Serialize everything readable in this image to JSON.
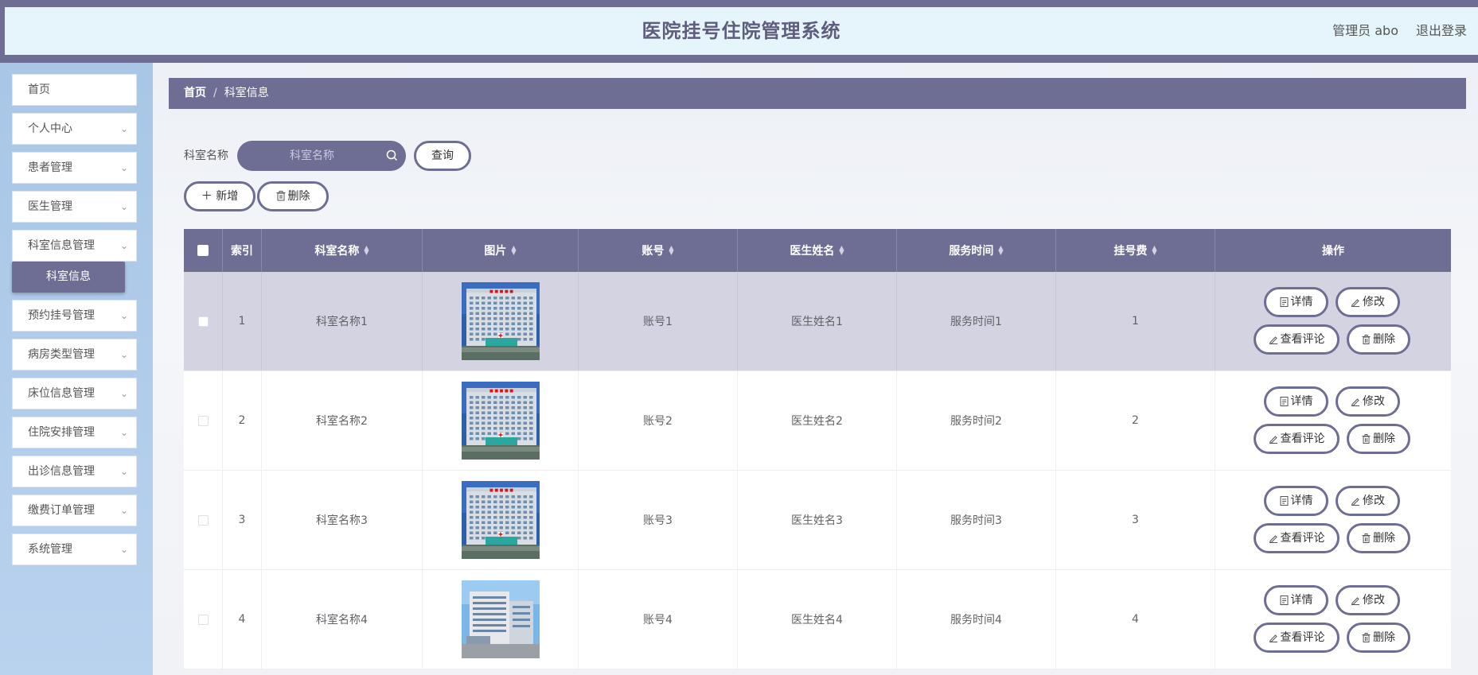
{
  "header": {
    "title": "医院挂号住院管理系统",
    "admin": "管理员 abo",
    "logout": "退出登录"
  },
  "sidebar": {
    "items": [
      {
        "label": "首页",
        "has_arrow": false
      },
      {
        "label": "个人中心",
        "has_arrow": true
      },
      {
        "label": "患者管理",
        "has_arrow": true
      },
      {
        "label": "医生管理",
        "has_arrow": true
      },
      {
        "label": "科室信息管理",
        "has_arrow": true
      },
      {
        "label": "预约挂号管理",
        "has_arrow": true
      },
      {
        "label": "病房类型管理",
        "has_arrow": true
      },
      {
        "label": "床位信息管理",
        "has_arrow": true
      },
      {
        "label": "住院安排管理",
        "has_arrow": true
      },
      {
        "label": "出诊信息管理",
        "has_arrow": true
      },
      {
        "label": "缴费订单管理",
        "has_arrow": true
      },
      {
        "label": "系统管理",
        "has_arrow": true
      }
    ],
    "active_sub": "科室信息"
  },
  "breadcrumb": {
    "home": "首页",
    "sep": "/",
    "current": "科室信息"
  },
  "search": {
    "label": "科室名称",
    "placeholder": "科室名称",
    "query_button": "查询"
  },
  "toolbar": {
    "add": "新增",
    "delete": "删除"
  },
  "table": {
    "headers": [
      "索引",
      "科室名称",
      "图片",
      "账号",
      "医生姓名",
      "服务时间",
      "挂号费",
      "操作"
    ],
    "rows": [
      {
        "index": "1",
        "name": "科室名称1",
        "account": "账号1",
        "doctor": "医生姓名1",
        "time": "服务时间1",
        "fee": "1"
      },
      {
        "index": "2",
        "name": "科室名称2",
        "account": "账号2",
        "doctor": "医生姓名2",
        "time": "服务时间2",
        "fee": "2"
      },
      {
        "index": "3",
        "name": "科室名称3",
        "account": "账号3",
        "doctor": "医生姓名3",
        "time": "服务时间3",
        "fee": "3"
      },
      {
        "index": "4",
        "name": "科室名称4",
        "account": "账号4",
        "doctor": "医生姓名4",
        "time": "服务时间4",
        "fee": "4"
      }
    ],
    "actions": {
      "detail": "详情",
      "edit": "修改",
      "comments": "查看评论",
      "delete": "删除"
    }
  },
  "colors": {
    "accent": "#6e6d93",
    "header_bg": "#e6f4fb",
    "sidebar_bg": "#b3cdea"
  }
}
